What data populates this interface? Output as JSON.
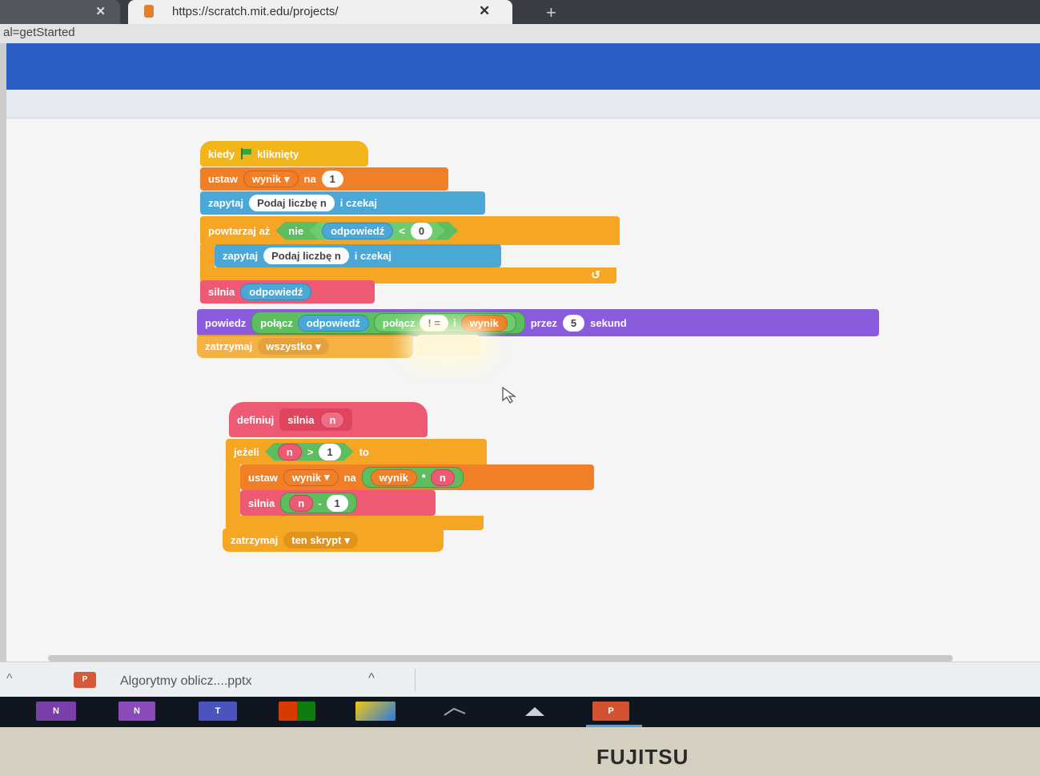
{
  "browser": {
    "tab_close": "✕",
    "active_tab_url": "https://scratch.mit.edu/projects/",
    "new_tab": "+",
    "address_fragment": "al=getStarted"
  },
  "script_main": {
    "hat": {
      "when": "kiedy",
      "flag_icon": "green-flag-icon",
      "clicked": "kliknięty"
    },
    "set_result": {
      "set": "ustaw",
      "var": "wynik",
      "to": "na",
      "value": "1"
    },
    "ask1": {
      "ask": "zapytaj",
      "question": "Podaj liczbę n",
      "wait": "i czekaj"
    },
    "repeat_until": {
      "label": "powtarzaj aż",
      "not": "nie",
      "answer": "odpowiedź",
      "lt": "<",
      "value": "0"
    },
    "ask2": {
      "ask": "zapytaj",
      "question": "Podaj liczbę n",
      "wait": "i czekaj"
    },
    "loop_arrow": "↺",
    "call_silnia": {
      "name": "silnia",
      "arg": "odpowiedź"
    },
    "say": {
      "say": "powiedz",
      "join1": "połącz",
      "answer": "odpowiedź",
      "join2": "połącz",
      "bang": "! =",
      "and": "i",
      "result": "wynik",
      "for": "przez",
      "secs": "5",
      "seconds": "sekund"
    },
    "stop": {
      "label": "zatrzymaj",
      "option": "wszystko"
    }
  },
  "script_define": {
    "define": {
      "label": "definiuj",
      "name": "silnia",
      "param": "n"
    },
    "if": {
      "label": "jeżeli",
      "n": "n",
      "gt": ">",
      "value": "1",
      "then": "to"
    },
    "set": {
      "set": "ustaw",
      "var": "wynik",
      "to": "na",
      "result": "wynik",
      "mul": "*",
      "n": "n"
    },
    "recurse": {
      "name": "silnia",
      "n": "n",
      "minus": "-",
      "value": "1"
    },
    "stop": {
      "label": "zatrzymaj",
      "option": "ten skrypt"
    }
  },
  "dropdown_arrow": "▾",
  "download_bar": {
    "file_icon": "P",
    "file_name": "Algorytmy oblicz....pptx",
    "chevron": "^",
    "left_chevron": "^"
  },
  "taskbar": {
    "apps": [
      {
        "name": "onenote-icon",
        "label": "N"
      },
      {
        "name": "onenote-icon-2",
        "label": "N"
      },
      {
        "name": "teams-icon",
        "label": "T"
      },
      {
        "name": "windows-apps-icon",
        "label": ""
      },
      {
        "name": "app-icon",
        "label": ""
      },
      {
        "name": "network-icon",
        "label": ""
      },
      {
        "name": "arrow-icon",
        "label": ""
      },
      {
        "name": "powerpoint-icon",
        "label": "P"
      }
    ]
  },
  "monitor": {
    "brand": "FUJITSU"
  },
  "colors": {
    "events": "#f2b51a",
    "variables": "#f07f28",
    "sensing": "#4aa7d6",
    "control": "#f5a623",
    "my_blocks": "#ee5a74",
    "operators": "#5ebd5e",
    "looks": "#8a5bdc"
  }
}
